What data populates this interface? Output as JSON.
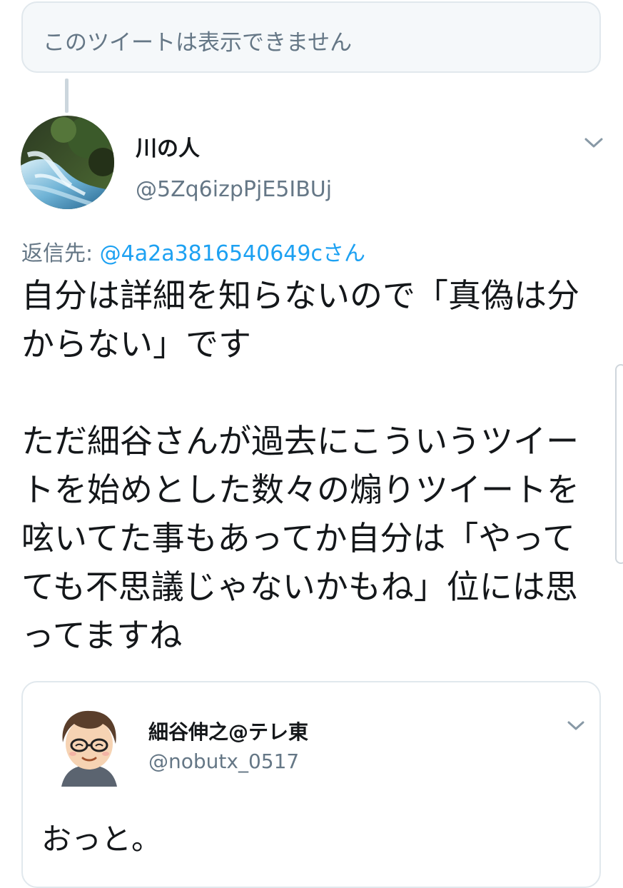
{
  "unavailable_notice": "このツイートは表示できません",
  "tweet": {
    "display_name": "川の人",
    "handle": "@5Zq6izpPjE5IBUj",
    "reply_label": "返信先: ",
    "reply_mention": "@4a2a3816540649cさん",
    "text": "自分は詳細を知らないので「真偽は分からない」です\n\nただ細谷さんが過去にこういうツイートを始めとした数々の煽りツイートを呟いてた事もあってか自分は「やってても不思議じゃないかもね」位には思ってますね",
    "avatar_icon": "waterfall-avatar",
    "menu_icon": "chevron-down-icon"
  },
  "quoted_tweet": {
    "display_name": "細谷伸之@テレ東",
    "handle": "@nobutx_0517",
    "text": "おっと。",
    "avatar_icon": "illustrated-person-avatar",
    "menu_icon": "chevron-down-icon"
  },
  "colors": {
    "text_primary": "#14171a",
    "text_secondary": "#657786",
    "link": "#1da1f2",
    "border": "#e1e8ed",
    "notice_bg": "#f5f8fa"
  }
}
